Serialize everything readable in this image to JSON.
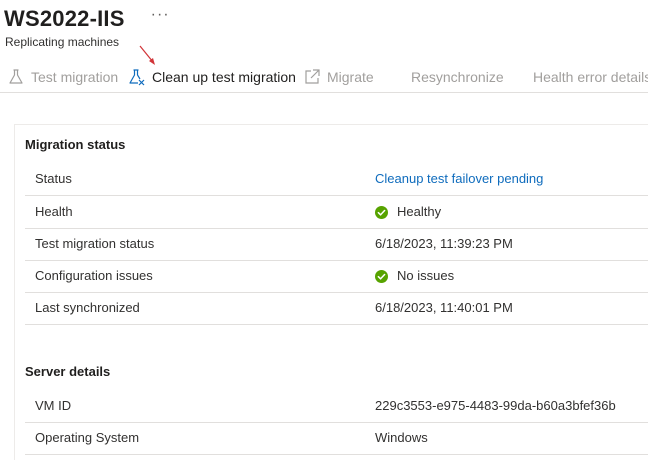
{
  "header": {
    "title": "WS2022-IIS",
    "more": "···",
    "subtitle": "Replicating machines"
  },
  "toolbar": {
    "test_migration": "Test migration",
    "cleanup_test_migration": "Clean up test migration",
    "migrate": "Migrate",
    "resynchronize": "Resynchronize",
    "health_error_details": "Health error details"
  },
  "migration_status": {
    "title": "Migration status",
    "rows": [
      {
        "label": "Status",
        "value": "Cleanup test failover pending"
      },
      {
        "label": "Health",
        "value": "Healthy"
      },
      {
        "label": "Test migration status",
        "value": "6/18/2023, 11:39:23 PM"
      },
      {
        "label": "Configuration issues",
        "value": "No issues"
      },
      {
        "label": "Last synchronized",
        "value": "6/18/2023, 11:40:01 PM"
      }
    ]
  },
  "server_details": {
    "title": "Server details",
    "rows": [
      {
        "label": "VM ID",
        "value": "229c3553-e975-4483-99da-b60a3bfef36b"
      },
      {
        "label": "Operating System",
        "value": "Windows"
      }
    ]
  },
  "colors": {
    "link": "#0f6cbd",
    "success": "#57a300",
    "disabled": "#a19f9d",
    "annotation": "#d13438"
  }
}
